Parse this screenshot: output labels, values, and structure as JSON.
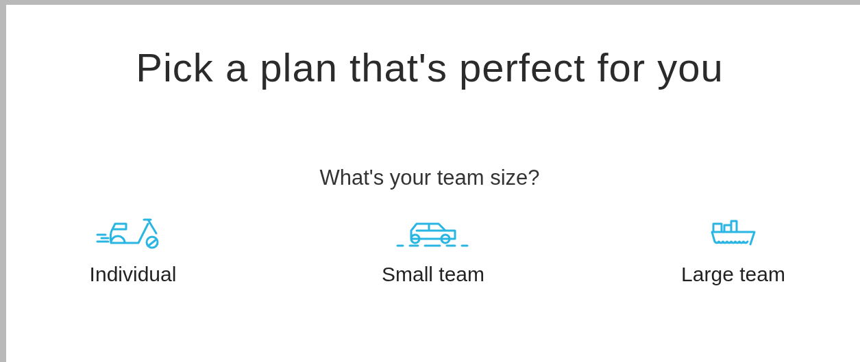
{
  "title": "Pick a plan that's perfect for you",
  "question": "What's your team size?",
  "options": [
    {
      "kind": "scooter",
      "label": "Individual"
    },
    {
      "kind": "car",
      "label": "Small team"
    },
    {
      "kind": "ship",
      "label": "Large team"
    }
  ]
}
